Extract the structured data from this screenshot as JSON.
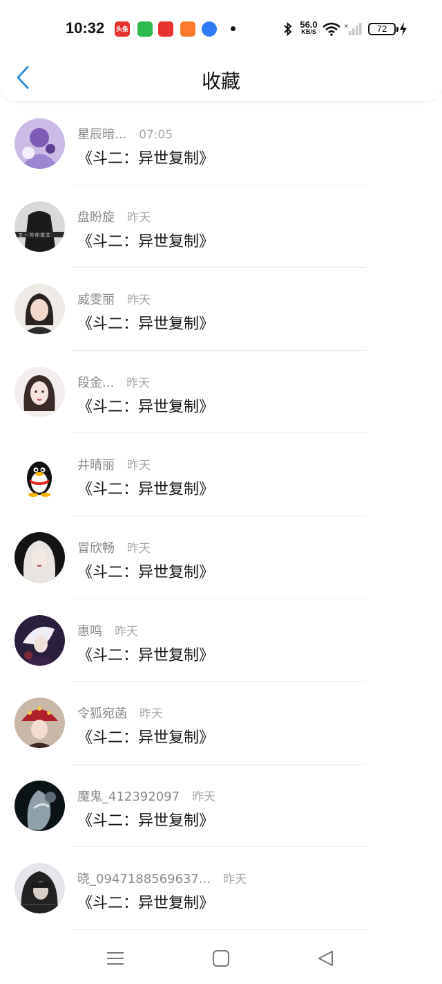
{
  "status_bar": {
    "time": "10:32",
    "app_icons": [
      {
        "name": "toutiao-app-icon",
        "label": "头条",
        "color": "#e8322f"
      },
      {
        "name": "green-app-icon",
        "label": "",
        "color": "#2dba4e"
      },
      {
        "name": "red-flag-app-icon",
        "label": "",
        "color": "#e8322f"
      },
      {
        "name": "orange-app-icon",
        "label": "",
        "color": "#ff7a2e"
      },
      {
        "name": "blue-app-icon",
        "label": "",
        "color": "#2f7cf6"
      }
    ],
    "net_speed_value": "56.0",
    "net_speed_unit": "KB/S",
    "battery": "72"
  },
  "header": {
    "title": "收藏",
    "back_icon": "chevron-left-icon",
    "accent": "#2f8fe0"
  },
  "favorites": [
    {
      "name": "星辰暗...",
      "time": "07:05",
      "content": "《斗二：异世复制》",
      "avatar": "anime-purple"
    },
    {
      "name": "盘盼旋",
      "time": "昨天",
      "content": "《斗二：异世复制》",
      "avatar": "dark-figure"
    },
    {
      "name": "威雯丽",
      "time": "昨天",
      "content": "《斗二：异世复制》",
      "avatar": "girl-light"
    },
    {
      "name": "段金...",
      "time": "昨天",
      "content": "《斗二：异世复制》",
      "avatar": "girl-pale"
    },
    {
      "name": "井晴丽",
      "time": "昨天",
      "content": "《斗二：异世复制》",
      "avatar": "qq-penguin"
    },
    {
      "name": "冒欣畅",
      "time": "昨天",
      "content": "《斗二：异世复制》",
      "avatar": "white-hair"
    },
    {
      "name": "惠鸣",
      "time": "昨天",
      "content": "《斗二：异世复制》",
      "avatar": "anime-dark"
    },
    {
      "name": "令狐宛菡",
      "time": "昨天",
      "content": "《斗二：异世复制》",
      "avatar": "opera-girl"
    },
    {
      "name": "魔鬼_412392097",
      "time": "昨天",
      "content": "《斗二：异世复制》",
      "avatar": "dark-smoke"
    },
    {
      "name": "晓_0947188569637...",
      "time": "昨天",
      "content": "《斗二：异世复制》",
      "avatar": "hooded"
    }
  ],
  "nav_bar": [
    "menu-icon",
    "home-square-icon",
    "back-triangle-icon"
  ]
}
